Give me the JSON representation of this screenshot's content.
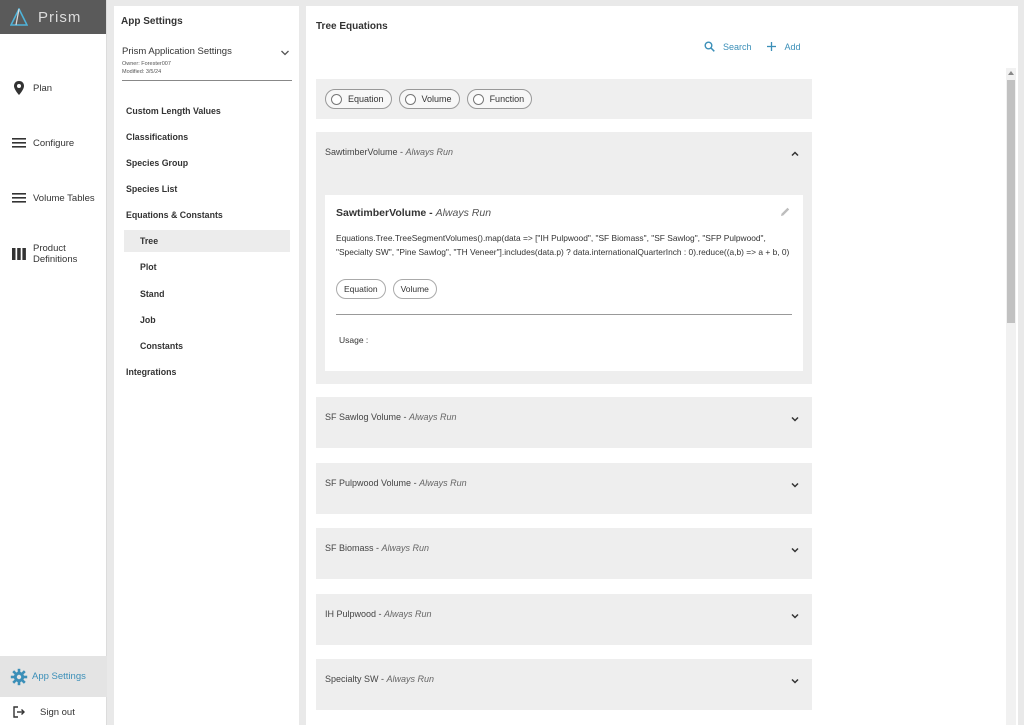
{
  "brand": {
    "name": "Prism"
  },
  "nav": {
    "items": [
      {
        "label": "Plan",
        "icon": "map-pin-icon"
      },
      {
        "label": "Configure",
        "icon": "list-icon"
      },
      {
        "label": "Volume Tables",
        "icon": "list-icon"
      },
      {
        "label": "Product Definitions",
        "icon": "columns-icon"
      }
    ],
    "app_settings": "App Settings",
    "sign_out": "Sign out"
  },
  "settings": {
    "title": "App Settings",
    "app": {
      "name": "Prism Application Settings",
      "owner": "Owner: Forester007",
      "modified": "Modified: 3/5/24"
    },
    "menu": {
      "custom_length": "Custom Length Values",
      "classifications": "Classifications",
      "species_group": "Species Group",
      "species_list": "Species List",
      "equations": "Equations & Constants",
      "tree": "Tree",
      "plot": "Plot",
      "stand": "Stand",
      "job": "Job",
      "constants": "Constants",
      "integrations": "Integrations"
    }
  },
  "main": {
    "title": "Tree Equations",
    "search": "Search",
    "add": "Add",
    "filters": [
      "Equation",
      "Volume",
      "Function"
    ],
    "equations": [
      {
        "name": "SawtimberVolume",
        "mode": "Always Run",
        "expanded": true,
        "code": "Equations.Tree.TreeSegmentVolumes().map(data => [\"IH Pulpwood\", \"SF Biomass\", \"SF Sawlog\", \"SFP Pulpwood\", \"Specialty SW\", \"Pine Sawlog\", \"TH Veneer\"].includes(data.p) ? data.internationalQuarterInch : 0).reduce((a,b) => a + b, 0)",
        "tags": [
          "Equation",
          "Volume"
        ],
        "usage": "Usage :"
      },
      {
        "name": "SF Sawlog Volume",
        "mode": "Always Run"
      },
      {
        "name": "SF Pulpwood Volume",
        "mode": "Always Run"
      },
      {
        "name": "SF Biomass",
        "mode": "Always Run"
      },
      {
        "name": "IH Pulpwood",
        "mode": "Always Run"
      },
      {
        "name": "Specialty SW",
        "mode": "Always Run"
      }
    ],
    "separator": " - "
  },
  "colors": {
    "accent": "#3b8fb8",
    "brand_bar": "#5a5a5a",
    "panel": "#eeeeee"
  }
}
